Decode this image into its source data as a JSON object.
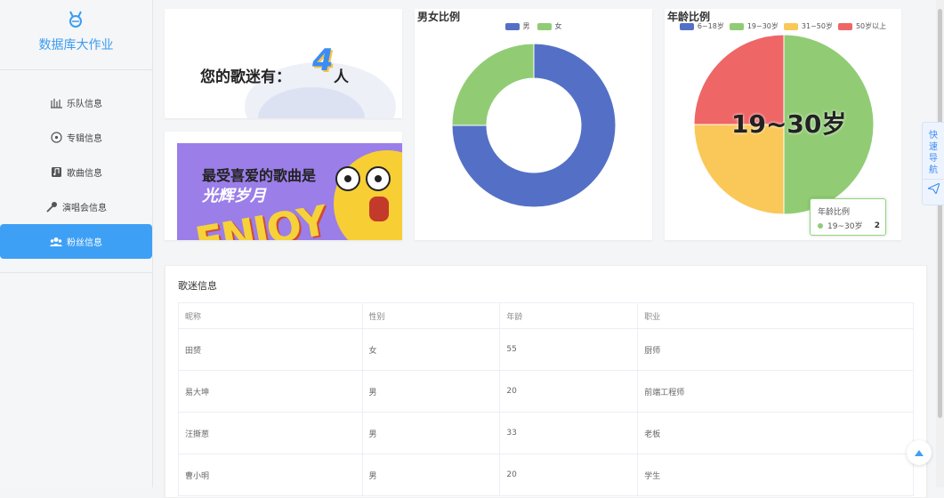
{
  "sidebar": {
    "logo_icon": "rabbit-logo-icon",
    "title": "数据库大作业",
    "items": [
      {
        "label": "乐队信息",
        "icon": "band-icon"
      },
      {
        "label": "专辑信息",
        "icon": "disc-icon"
      },
      {
        "label": "歌曲信息",
        "icon": "music-note-icon"
      },
      {
        "label": "演唱会信息",
        "icon": "microphone-icon"
      },
      {
        "label": "粉丝信息",
        "icon": "users-icon",
        "active": true
      }
    ]
  },
  "fans": {
    "label": "您的歌迷有：",
    "count": "4",
    "unit": "人"
  },
  "song": {
    "line1": "最受喜爱的歌曲是",
    "line2": "光辉岁月",
    "art_text": "ENJOY"
  },
  "colors": {
    "blue": "#5470c6",
    "green": "#91cc75",
    "yellow": "#fac858",
    "red": "#ee6666",
    "accent": "#3ea0f5"
  },
  "chart_data": [
    {
      "type": "pie",
      "title": "男女比例",
      "donut": true,
      "legend_position": "top",
      "series": [
        {
          "name": "男",
          "value": 3,
          "color": "#5470c6"
        },
        {
          "name": "女",
          "value": 1,
          "color": "#91cc75"
        }
      ]
    },
    {
      "type": "pie",
      "title": "年龄比例",
      "legend_position": "top",
      "series": [
        {
          "name": "6~18岁",
          "value": 0,
          "color": "#5470c6"
        },
        {
          "name": "19~30岁",
          "value": 2,
          "color": "#91cc75"
        },
        {
          "name": "31~50岁",
          "value": 1,
          "color": "#fac858"
        },
        {
          "name": "50岁以上",
          "value": 1,
          "color": "#ee6666"
        }
      ],
      "emphasis_label": "19~30岁",
      "tooltip": {
        "title": "年龄比例",
        "name": "19~30岁",
        "value": "2"
      }
    }
  ],
  "table": {
    "title": "歌迷信息",
    "columns": [
      "昵称",
      "性别",
      "年龄",
      "职业"
    ],
    "rows": [
      [
        "田赟",
        "女",
        "55",
        "厨师"
      ],
      [
        "易大坤",
        "男",
        "20",
        "前端工程师"
      ],
      [
        "汪撕葱",
        "男",
        "33",
        "老板"
      ],
      [
        "曹小明",
        "男",
        "20",
        "学生"
      ]
    ]
  },
  "quick_nav": {
    "label": "快速导航",
    "icon": "send-icon"
  },
  "back_top": {
    "icon": "arrow-up-icon"
  }
}
